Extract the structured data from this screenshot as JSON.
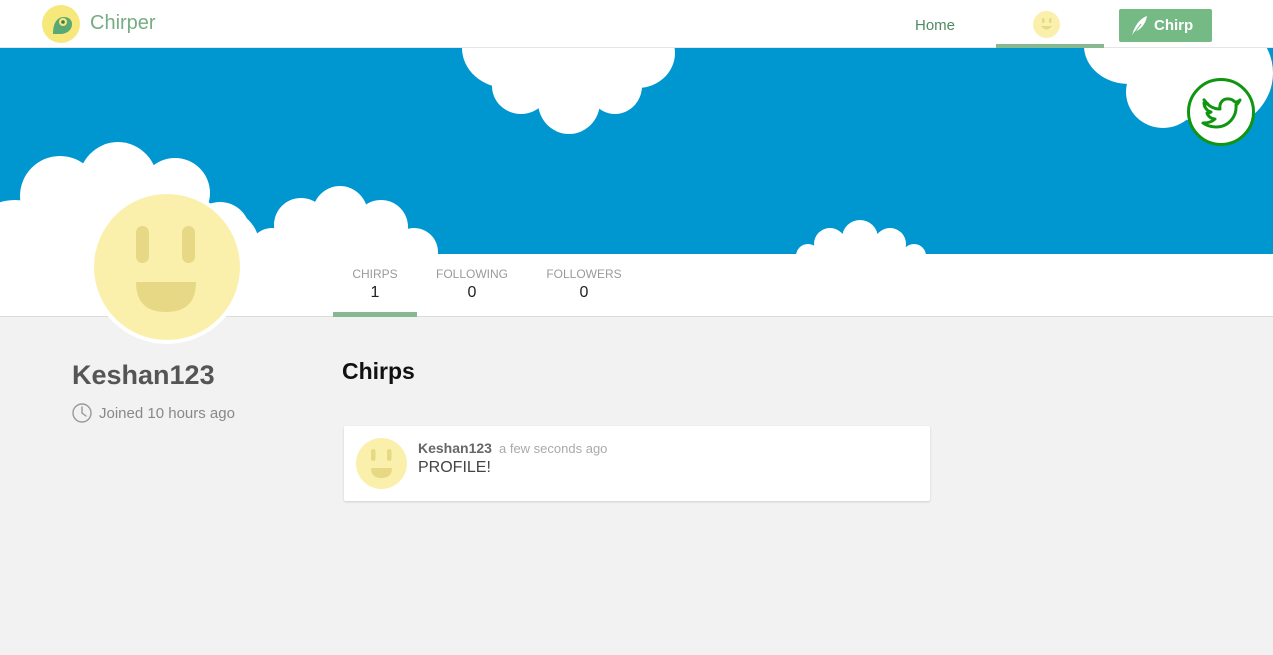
{
  "brand": {
    "name": "Chirper",
    "logo_icon": "bird-logo-icon"
  },
  "nav": {
    "home_label": "Home",
    "chirp_label": "Chirp",
    "chirp_icon": "feather-icon"
  },
  "colors": {
    "banner": "#0096cf",
    "accent": "#75b985",
    "avatar": "#fbf0ab",
    "twitter_badge": "#109510"
  },
  "profile": {
    "username": "Keshan123",
    "joined": "Joined 10 hours ago",
    "stats": [
      {
        "label": "CHIRPS",
        "value": "1"
      },
      {
        "label": "FOLLOWING",
        "value": "0"
      },
      {
        "label": "FOLLOWERS",
        "value": "0"
      }
    ],
    "active_stat": "CHIRPS"
  },
  "feed": {
    "title": "Chirps",
    "chirps": [
      {
        "user": "Keshan123",
        "time": "a few seconds ago",
        "text": "PROFILE!"
      }
    ]
  }
}
